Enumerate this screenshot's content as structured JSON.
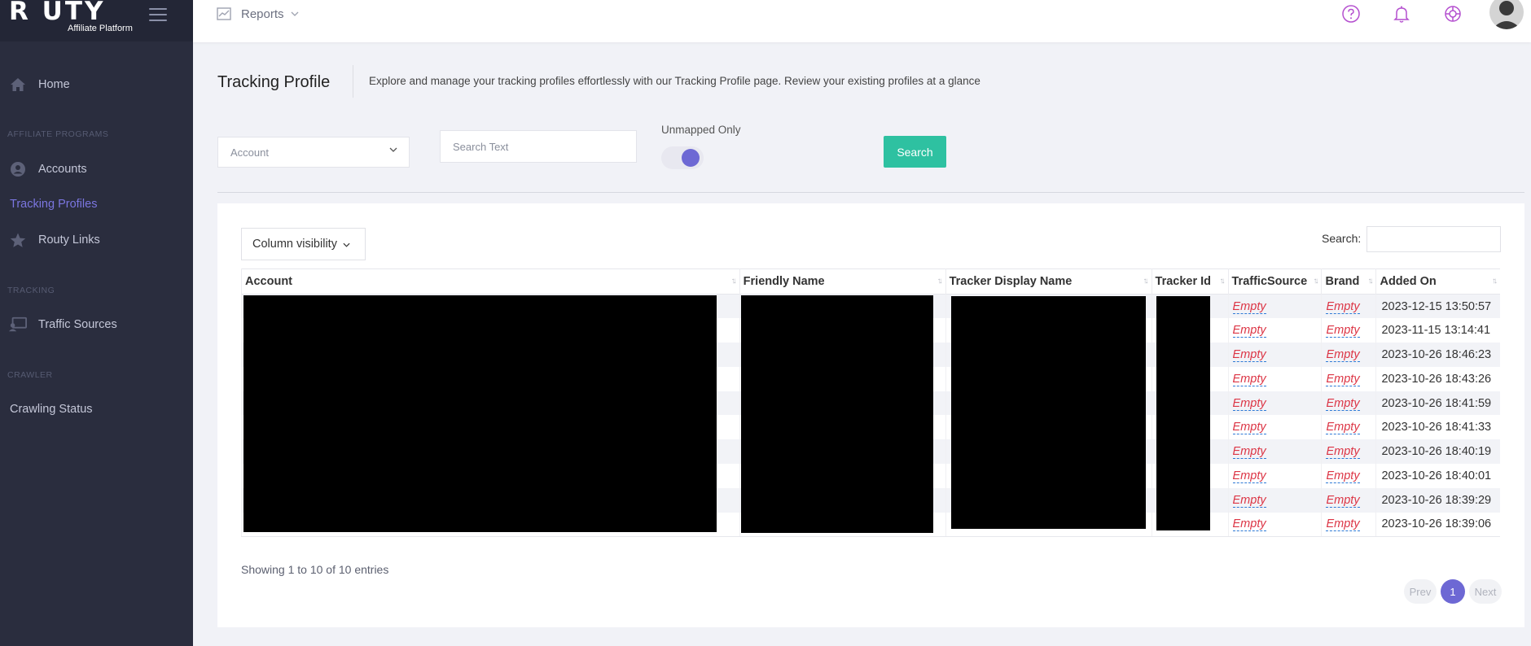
{
  "app": {
    "name": "R UTY",
    "subtitle": "Affiliate Platform"
  },
  "sidebar": {
    "home": "Home",
    "sections": {
      "affiliate": "AFFILIATE PROGRAMS",
      "tracking": "TRACKING",
      "crawler": "CRAWLER"
    },
    "items": {
      "accounts": "Accounts",
      "tracking_profiles": "Tracking Profiles",
      "routy_links": "Routy Links",
      "traffic_sources": "Traffic Sources",
      "crawling_status": "Crawling Status"
    }
  },
  "topbar": {
    "reports": "Reports"
  },
  "page": {
    "title": "Tracking Profile",
    "description": "Explore and manage your tracking profiles effortlessly with our Tracking Profile page. Review your existing profiles at a glance"
  },
  "filters": {
    "account_placeholder": "Account",
    "search_placeholder": "Search Text",
    "unmapped_label": "Unmapped Only",
    "search_button": "Search"
  },
  "table_controls": {
    "column_visibility": "Column visibility",
    "search_label": "Search:"
  },
  "table": {
    "columns": [
      "Account",
      "Friendly Name",
      "Tracker Display Name",
      "Tracker Id",
      "TrafficSource",
      "Brand",
      "Added On"
    ],
    "empty_text": "Empty",
    "rows": [
      {
        "added_on": "2023-12-15 13:50:57"
      },
      {
        "added_on": "2023-11-15 13:14:41"
      },
      {
        "added_on": "2023-10-26 18:46:23"
      },
      {
        "added_on": "2023-10-26 18:43:26"
      },
      {
        "added_on": "2023-10-26 18:41:59"
      },
      {
        "added_on": "2023-10-26 18:41:33"
      },
      {
        "added_on": "2023-10-26 18:40:19"
      },
      {
        "added_on": "2023-10-26 18:40:01"
      },
      {
        "added_on": "2023-10-26 18:39:29"
      },
      {
        "added_on": "2023-10-26 18:39:06"
      }
    ]
  },
  "footer": {
    "showing": "Showing 1 to 10 of 10 entries",
    "prev": "Prev",
    "page": "1",
    "next": "Next"
  },
  "colors": {
    "accent": "#6d68d4",
    "search_button": "#2ec1a1",
    "sidebar": "#2a2d3e",
    "empty": "#dc3545"
  },
  "icons": {
    "help": "question-circle-icon",
    "notify": "bell-icon",
    "support": "lifebuoy-icon",
    "reports": "chart-icon"
  }
}
